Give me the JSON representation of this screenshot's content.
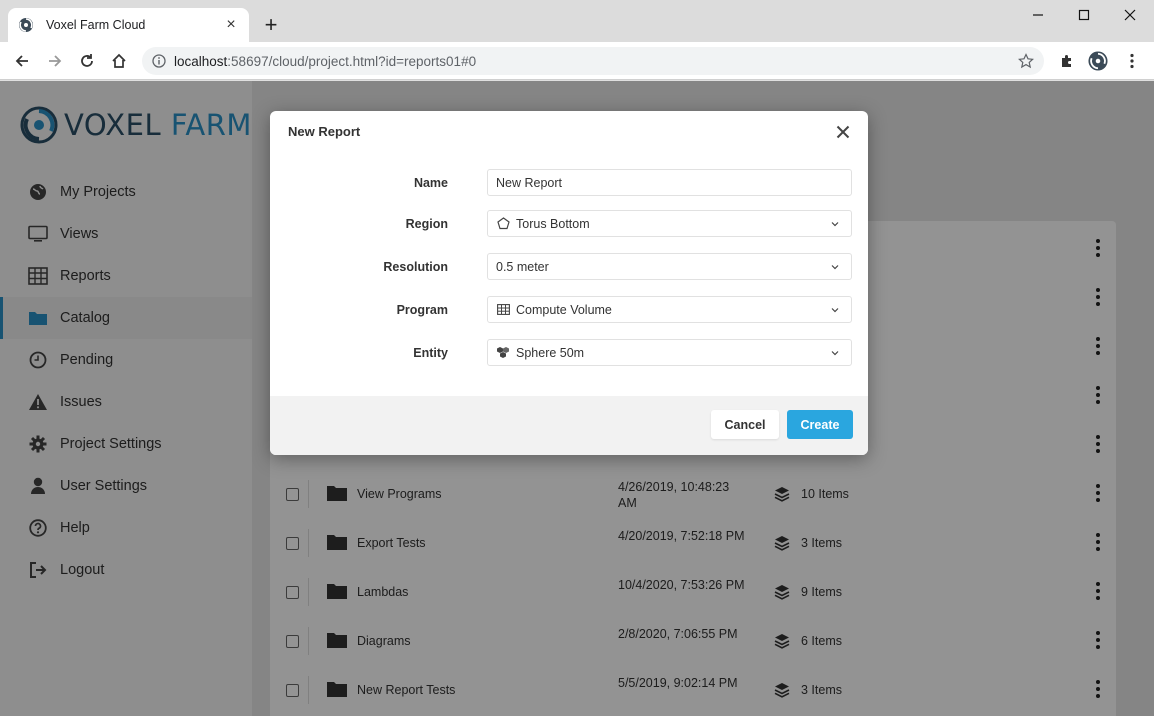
{
  "browser": {
    "tab_title": "Voxel Farm Cloud",
    "url_host": "localhost",
    "url_rest": ":58697/cloud/project.html?id=reports01#0"
  },
  "sidebar": {
    "logo_part1": "VOXEL",
    "logo_part2": "FARM",
    "items": [
      {
        "label": "My Projects",
        "icon": "globe-icon"
      },
      {
        "label": "Views",
        "icon": "monitor-icon"
      },
      {
        "label": "Reports",
        "icon": "table-icon"
      },
      {
        "label": "Catalog",
        "icon": "folder-icon",
        "active": true
      },
      {
        "label": "Pending",
        "icon": "clock-icon"
      },
      {
        "label": "Issues",
        "icon": "warning-icon"
      },
      {
        "label": "Project Settings",
        "icon": "gear-icon"
      },
      {
        "label": "User Settings",
        "icon": "user-icon"
      },
      {
        "label": "Help",
        "icon": "help-icon"
      },
      {
        "label": "Logout",
        "icon": "logout-icon"
      }
    ]
  },
  "catalog": {
    "rows": [
      {
        "name": "View Programs",
        "date": "4/26/2019, 10:48:23 AM",
        "items": "10 Items"
      },
      {
        "name": "Export Tests",
        "date": "4/20/2019, 7:52:18 PM",
        "items": "3 Items"
      },
      {
        "name": "Lambdas",
        "date": "10/4/2020, 7:53:26 PM",
        "items": "9 Items"
      },
      {
        "name": "Diagrams",
        "date": "2/8/2020, 7:06:55 PM",
        "items": "6 Items"
      },
      {
        "name": "New Report Tests",
        "date": "5/5/2019, 9:02:14 PM",
        "items": "3 Items"
      }
    ]
  },
  "modal": {
    "title": "New Report",
    "fields": {
      "name": {
        "label": "Name",
        "value": "New Report"
      },
      "region": {
        "label": "Region",
        "value": "Torus Bottom",
        "icon": "pentagon-icon"
      },
      "resolution": {
        "label": "Resolution",
        "value": "0.5 meter"
      },
      "program": {
        "label": "Program",
        "value": "Compute Volume",
        "icon": "table-icon"
      },
      "entity": {
        "label": "Entity",
        "value": "Sphere 50m",
        "icon": "cubes-icon"
      }
    },
    "cancel_label": "Cancel",
    "create_label": "Create"
  },
  "colors": {
    "accent": "#2aa6df",
    "logo_dark": "#2a4e66",
    "logo_light": "#2a8fc4"
  }
}
